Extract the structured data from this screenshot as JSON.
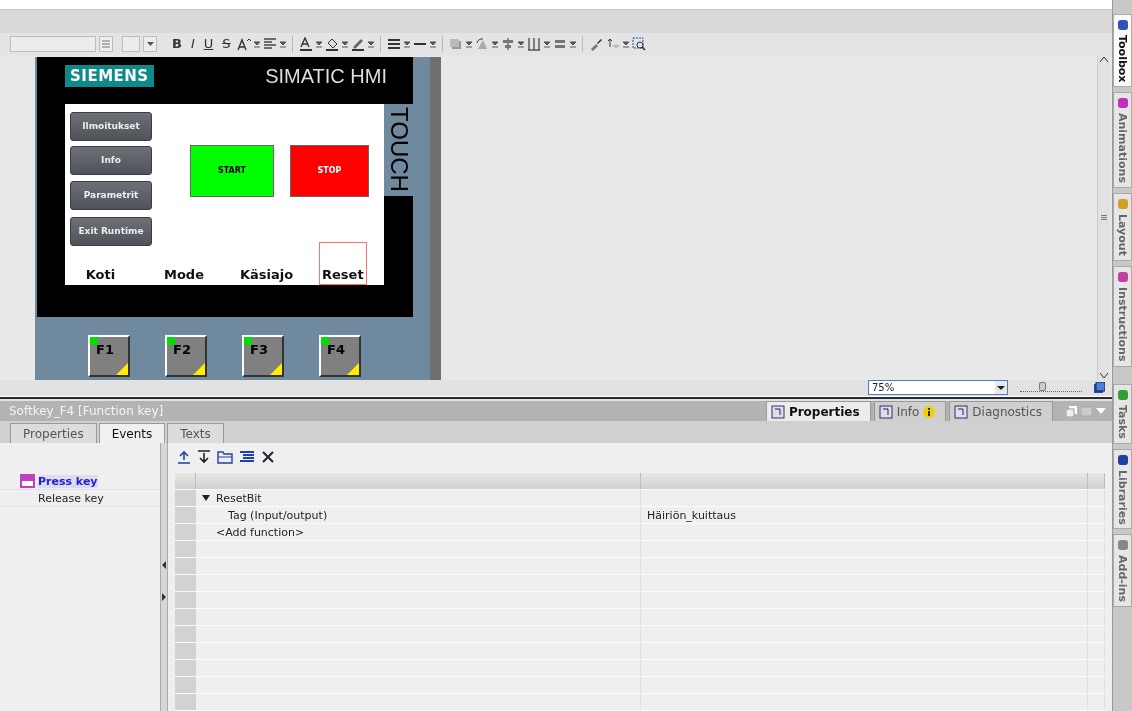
{
  "toolbar": {
    "text_buttons": [
      "B",
      "I",
      "U",
      "S"
    ]
  },
  "hmi": {
    "brand": "SIEMENS",
    "model": "SIMATIC HMI",
    "side_label": "TOUCH",
    "screen_buttons": [
      {
        "label": "Ilmoitukset"
      },
      {
        "label": "Info"
      },
      {
        "label": "Parametrit"
      },
      {
        "label": "Exit Runtime"
      }
    ],
    "controls": [
      {
        "label": "START",
        "color": "#00ff00"
      },
      {
        "label": "STOP",
        "color": "#ff0000"
      }
    ],
    "softkey_labels": [
      {
        "label": "Koti",
        "selected": false
      },
      {
        "label": "Mode",
        "selected": false
      },
      {
        "label": "Käsiajo",
        "selected": false
      },
      {
        "label": "Reset",
        "selected": true
      }
    ],
    "function_keys": [
      {
        "label": "F1"
      },
      {
        "label": "F2"
      },
      {
        "label": "F3"
      },
      {
        "label": "F4"
      }
    ]
  },
  "zoom": {
    "value": "75%",
    "level": 0.3
  },
  "properties_panel": {
    "title": "Softkey_F4 [Function key]",
    "view_tabs": [
      {
        "label": "Properties",
        "selected": true
      },
      {
        "label": "Info",
        "selected": false
      },
      {
        "label": "Diagnostics",
        "selected": false
      }
    ],
    "tabs": [
      {
        "label": "Properties",
        "selected": false
      },
      {
        "label": "Events",
        "selected": true
      },
      {
        "label": "Texts",
        "selected": false
      }
    ],
    "events": [
      {
        "label": "Press key",
        "selected": true
      },
      {
        "label": "Release key",
        "selected": false
      }
    ],
    "function_list": [
      {
        "kind": "function",
        "name": "ResetBit",
        "expanded": true,
        "children": [
          {
            "name": "Tag (Input/output)",
            "value": "Häiriön_kuittaus"
          }
        ]
      },
      {
        "kind": "add",
        "name": "<Add function>"
      }
    ]
  },
  "side_tabs": [
    {
      "label": "Toolbox",
      "selected": true
    },
    {
      "label": "Animations",
      "selected": false
    },
    {
      "label": "Layout",
      "selected": false
    },
    {
      "label": "Instructions",
      "selected": false
    },
    {
      "label": "Tasks",
      "selected": false
    },
    {
      "label": "Libraries",
      "selected": false
    },
    {
      "label": "Add-ins",
      "selected": false
    }
  ]
}
